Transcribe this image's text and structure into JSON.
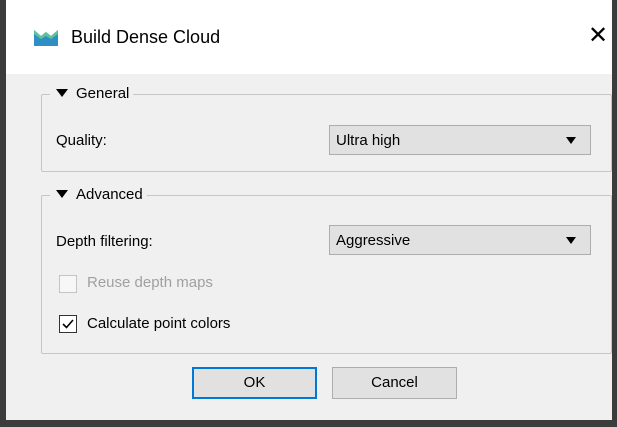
{
  "window": {
    "title": "Build Dense Cloud",
    "icon": "metashape-app-icon",
    "close_glyph": "✕"
  },
  "general": {
    "legend": "General",
    "quality_label": "Quality:",
    "quality_value": "Ultra high"
  },
  "advanced": {
    "legend": "Advanced",
    "depth_filtering_label": "Depth filtering:",
    "depth_filtering_value": "Aggressive",
    "reuse_depth_maps_label": "Reuse depth maps",
    "reuse_depth_maps_checked": false,
    "reuse_depth_maps_enabled": false,
    "calculate_point_colors_label": "Calculate point colors",
    "calculate_point_colors_checked": true
  },
  "buttons": {
    "ok_label": "OK",
    "cancel_label": "Cancel"
  },
  "colors": {
    "default_button_border": "#0078d7",
    "disabled_text": "#a0a0a0"
  }
}
